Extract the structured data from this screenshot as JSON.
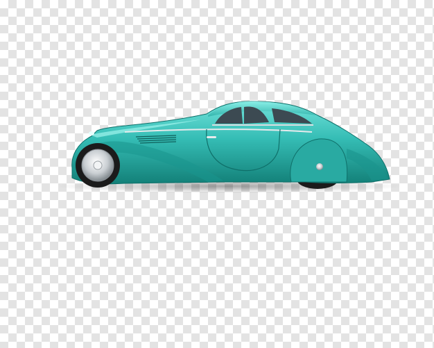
{
  "image": {
    "background": "transparency-checkerboard",
    "checker_colors": [
      "#ffffff",
      "#e3e3e3"
    ],
    "subject": "vintage-coupe"
  },
  "car": {
    "body_color": "#2fb7b0",
    "body_highlight": "#6fe0d8",
    "body_shadow": "#127f7b",
    "chrome_color": "#d9dde0",
    "window_color": "#3c4a52",
    "tire_color": "#1b1b1b"
  }
}
